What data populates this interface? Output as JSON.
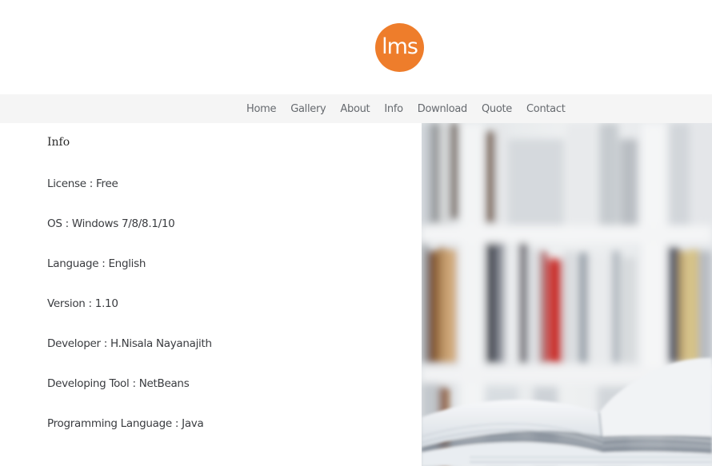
{
  "header": {
    "logo_text": "lms",
    "logo_color": "#ee7d2b"
  },
  "nav": {
    "items": [
      "Home",
      "Gallery",
      "About",
      "Info",
      "Download",
      "Quote",
      "Contact"
    ]
  },
  "info": {
    "title": "Info",
    "items": [
      "License : Free",
      "OS : Windows 7/8/8.1/10",
      "Language : English",
      "Version : 1.10",
      "Developer : H.Nisala Nayanajith",
      "Developing Tool : NetBeans",
      "Programming Language : Java"
    ]
  },
  "hero": {
    "image_subject": "blurred bookshelf with open book"
  }
}
